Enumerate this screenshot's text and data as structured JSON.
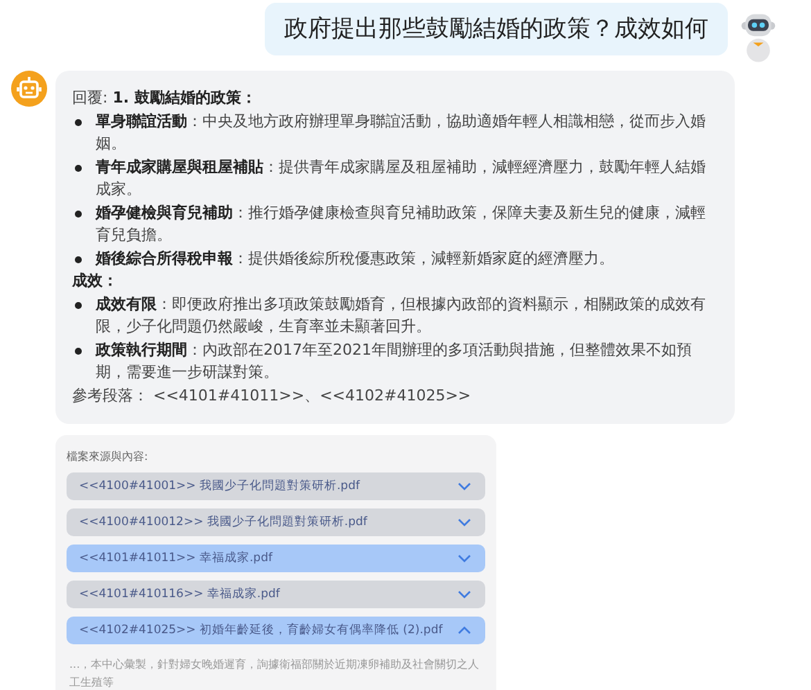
{
  "user_message": {
    "text": "政府提出那些鼓勵結婚的政策？成效如何"
  },
  "answer": {
    "lines": [
      {
        "kind": "text",
        "text": "回覆: **1. 鼓勵結婚的政策：**"
      },
      {
        "kind": "bullet",
        "title": "單身聯誼活動",
        "text": "：中央及地方政府辦理單身聯誼活動，協助適婚年輕人相識相戀，從而步入婚姻。"
      },
      {
        "kind": "bullet",
        "title": "青年成家購屋與租屋補貼",
        "text": "：提供青年成家購屋及租屋補助，減輕經濟壓力，鼓勵年輕人結婚成家。"
      },
      {
        "kind": "bullet",
        "title": "婚孕健檢與育兒補助",
        "text": "：推行婚孕健康檢查與育兒補助政策，保障夫妻及新生兒的健康，減輕育兒負擔。"
      },
      {
        "kind": "bullet",
        "title": "婚後綜合所得稅申報",
        "text": "：提供婚後綜所稅優惠政策，減輕新婚家庭的經濟壓力。"
      },
      {
        "kind": "heading",
        "text": "成效："
      },
      {
        "kind": "bullet",
        "title": "成效有限",
        "text": "：即便政府推出多項政策鼓勵婚育，但根據內政部的資料顯示，相關政策的成效有限，少子化問題仍然嚴峻，生育率並未顯著回升。"
      },
      {
        "kind": "bullet",
        "title": "政策執行期間",
        "text": "：內政部在2017年至2021年間辦理的多項活動與措施，但整體效果不如預期，需要進一步研謀對策。"
      },
      {
        "kind": "text",
        "text": "參考段落： <<4101#41011>>、<<4102#41025>>"
      }
    ]
  },
  "sources": {
    "label": "檔案來源與內容:",
    "items": [
      {
        "title": "<<4100#41001>> 我國少子化問題對策研析.pdf",
        "highlighted": false,
        "expanded": false
      },
      {
        "title": "<<4100#410012>> 我國少子化問題對策研析.pdf",
        "highlighted": false,
        "expanded": false
      },
      {
        "title": "<<4101#41011>> 幸福成家.pdf",
        "highlighted": true,
        "expanded": false
      },
      {
        "title": "<<4101#410116>> 幸福成家.pdf",
        "highlighted": false,
        "expanded": false
      },
      {
        "title": "<<4102#41025>> 初婚年齡延後，育齡婦女有偶率降低 (2).pdf",
        "highlighted": true,
        "expanded": true,
        "content": "...，本中心彙製，針對婦女晚婚遲育，詢據衛福部關於近期凍卵補助及社會關切之人工生殖等"
      }
    ]
  }
}
